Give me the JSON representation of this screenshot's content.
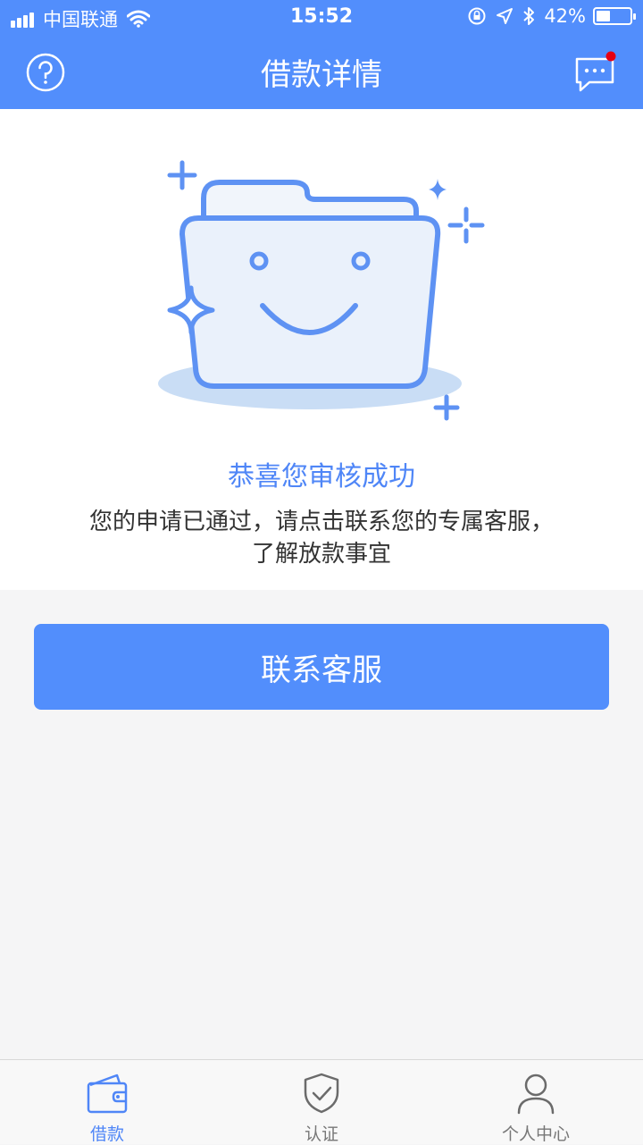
{
  "status_bar": {
    "carrier": "中国联通",
    "time": "15:52",
    "battery": "42%",
    "battery_level": 0.42,
    "icons": [
      "signal-icon",
      "wifi-icon",
      "orientation-lock-icon",
      "location-icon",
      "bluetooth-icon",
      "battery-icon"
    ]
  },
  "nav": {
    "title": "借款详情",
    "left_icon": "help-circle-icon",
    "right_icon": "message-icon",
    "right_badge": true
  },
  "result": {
    "title": "恭喜您审核成功",
    "description_line1": "您的申请已通过，请点击联系您的专属客服，",
    "description_line2": "了解放款事宜",
    "illustration": "smiling-folder-illustration"
  },
  "actions": {
    "contact_label": "联系客服"
  },
  "tabbar": {
    "tabs": [
      {
        "label": "借款",
        "icon": "wallet-icon",
        "active": true
      },
      {
        "label": "认证",
        "icon": "shield-check-icon",
        "active": false
      },
      {
        "label": "个人中心",
        "icon": "person-icon",
        "active": false
      }
    ]
  },
  "colors": {
    "primary": "#528efc",
    "accent_text": "#4f86f7",
    "badge": "#e60012",
    "background": "#f5f5f6"
  }
}
